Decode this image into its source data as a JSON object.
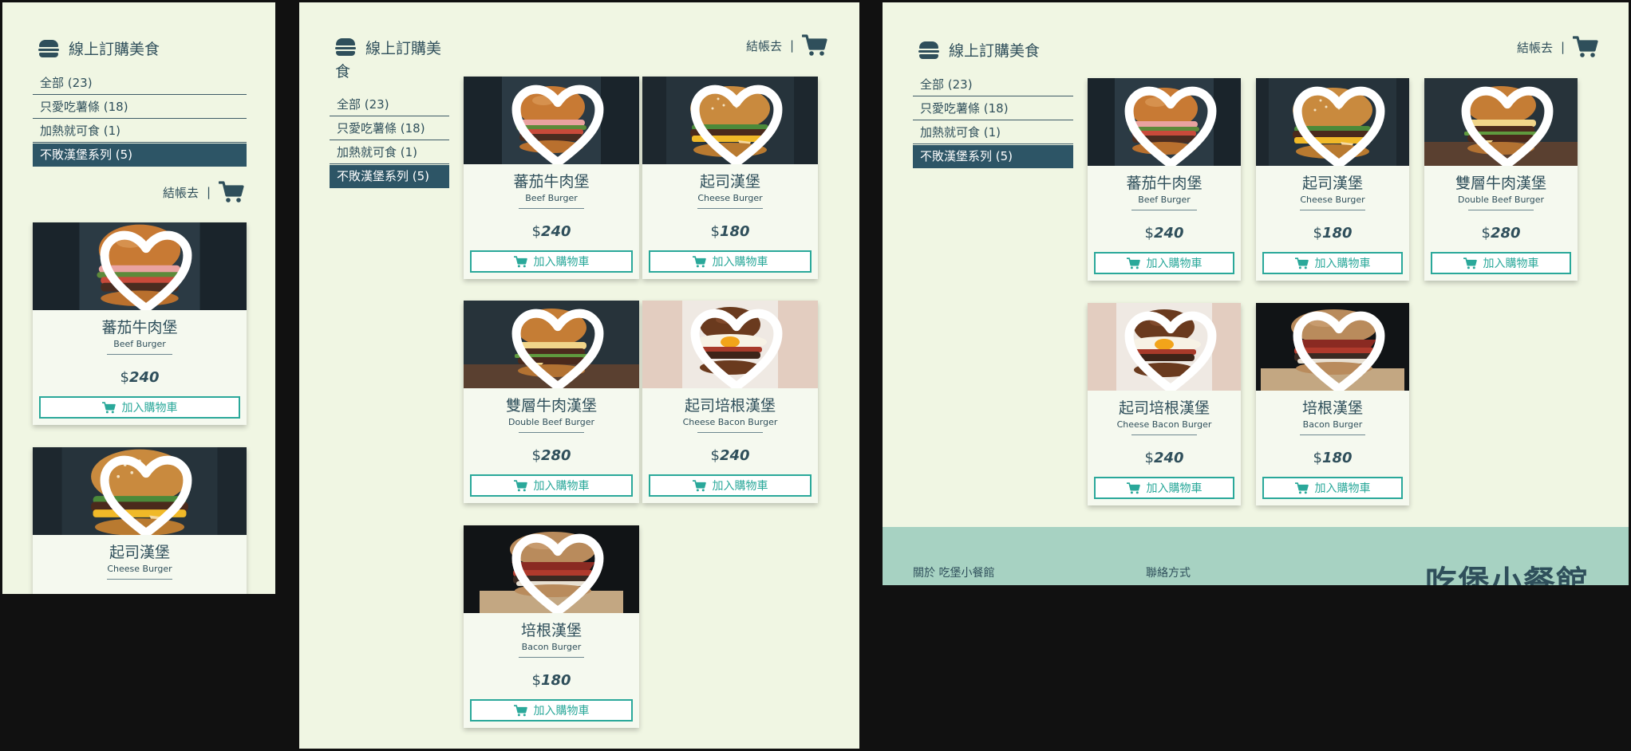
{
  "brand": {
    "title": "線上訂購美食",
    "icon": "burger-icon"
  },
  "categories": [
    {
      "label": "全部 (23)"
    },
    {
      "label": "只愛吃薯條 (18)"
    },
    {
      "label": "加熱就可食 (1)"
    },
    {
      "label": "不敗漢堡系列 (5)",
      "active": true
    }
  ],
  "checkout": {
    "label": "結帳去",
    "separator": "|",
    "icon": "shopping-cart-icon"
  },
  "products": [
    {
      "name": "蕃茄牛肉堡",
      "en": "Beef Burger",
      "currency": "$",
      "price": "240",
      "button": "加入購物車"
    },
    {
      "name": "起司漢堡",
      "en": "Cheese Burger",
      "currency": "$",
      "price": "180",
      "button": "加入購物車"
    },
    {
      "name": "雙層牛肉漢堡",
      "en": "Double Beef Burger",
      "currency": "$",
      "price": "280",
      "button": "加入購物車"
    },
    {
      "name": "起司培根漢堡",
      "en": "Cheese Bacon Burger",
      "currency": "$",
      "price": "240",
      "button": "加入購物車"
    },
    {
      "name": "培根漢堡",
      "en": "Bacon Burger",
      "currency": "$",
      "price": "180",
      "button": "加入購物車"
    }
  ],
  "footer": {
    "about": "關於 吃堡小餐館",
    "contact": "聯絡方式",
    "logo": "吃堡小餐館"
  },
  "colors": {
    "panel_bg": "#f0f6e3",
    "primary": "#2f4f5b",
    "accent": "#2aa89a",
    "active_bg": "#2d5566",
    "footer_bg": "#a7d2c2"
  }
}
